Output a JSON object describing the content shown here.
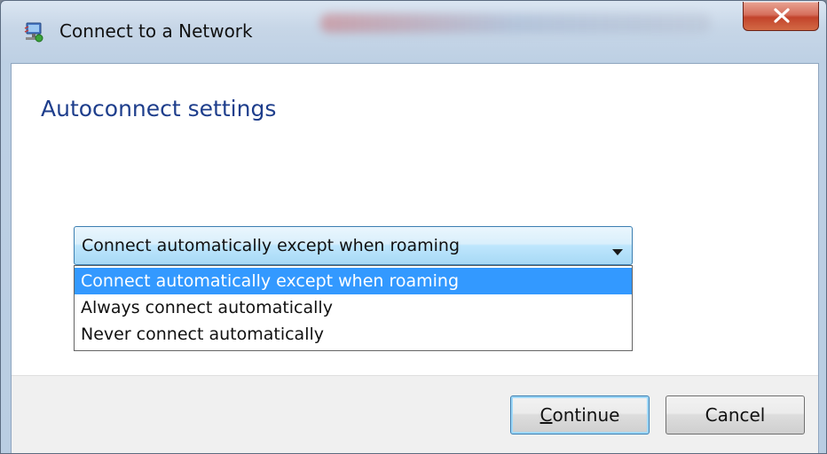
{
  "window": {
    "title": "Connect to a Network",
    "icon": "network-connect-icon",
    "close_icon": "close-icon"
  },
  "main": {
    "heading": "Autoconnect settings"
  },
  "combo": {
    "selected": "Connect automatically except when roaming",
    "arrow_icon": "chevron-down-icon",
    "options": [
      {
        "label": "Connect automatically except when roaming",
        "highlighted": true
      },
      {
        "label": "Always connect automatically",
        "highlighted": false
      },
      {
        "label": "Never connect automatically",
        "highlighted": false
      }
    ]
  },
  "buttons": {
    "continue_label_accel": "C",
    "continue_label_rest": "ontinue",
    "cancel_label": "Cancel"
  },
  "colors": {
    "heading": "#1e3e8c",
    "selection": "#3399ff",
    "close_button": "#c2432b"
  }
}
